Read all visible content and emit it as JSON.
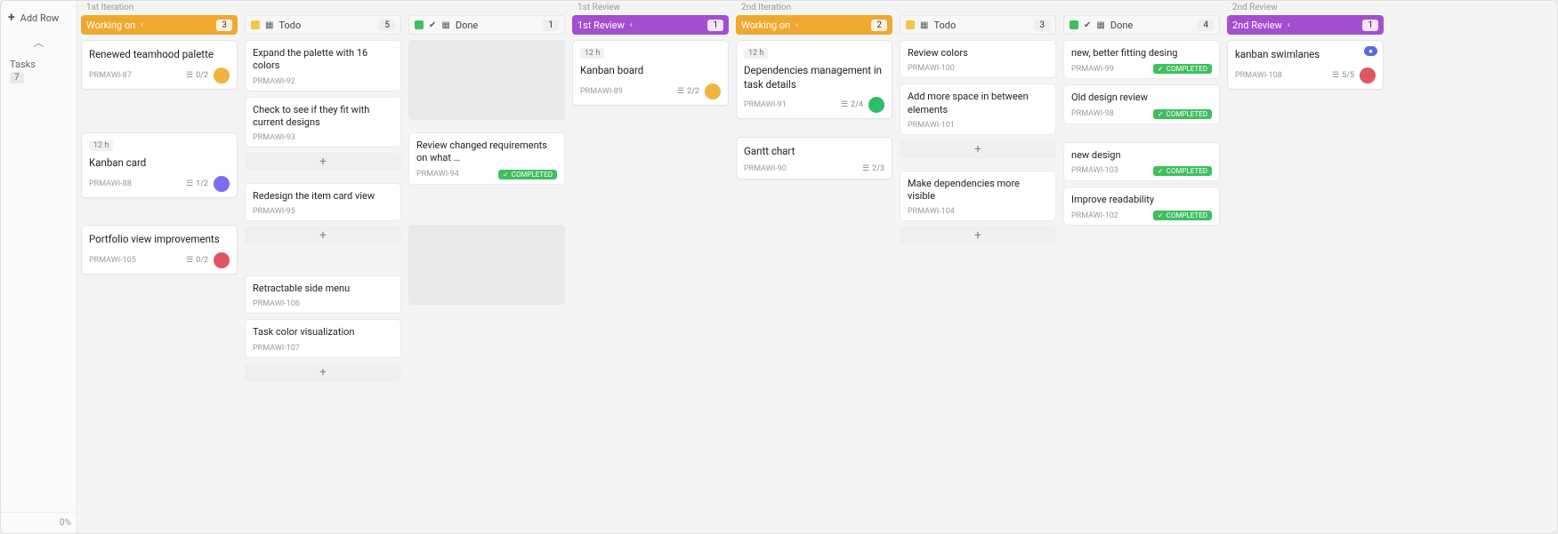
{
  "sidebar": {
    "add_row": "Add Row",
    "tasks_label": "Tasks",
    "tasks_count": "7",
    "progress": "0%"
  },
  "stages": [
    {
      "label": "1st Iteration"
    },
    {
      "label": "1st Review"
    },
    {
      "label": "2nd Iteration"
    },
    {
      "label": "2nd Review"
    }
  ],
  "columns": {
    "s1_working": {
      "title": "Working on",
      "count": "3"
    },
    "s1_todo": {
      "title": "Todo",
      "count": "5"
    },
    "s1_done": {
      "title": "Done",
      "count": "1"
    },
    "s1_review": {
      "title": "1st Review",
      "count": "1"
    },
    "s2_working": {
      "title": "Working on",
      "count": "2"
    },
    "s2_todo": {
      "title": "Todo",
      "count": "3"
    },
    "s2_done": {
      "title": "Done",
      "count": "4"
    },
    "s2_review": {
      "title": "2nd Review",
      "count": "1"
    }
  },
  "labels": {
    "time_12h": "12 h",
    "completed": "COMPLETED"
  },
  "cards": {
    "c87": {
      "title": "Renewed teamhood palette",
      "code": "PRMAWI-87",
      "sub": "0/2"
    },
    "c92": {
      "title": "Expand the palette with 16 colors",
      "code": "PRMAWI-92"
    },
    "c93": {
      "title": "Check to see if they fit with current designs",
      "code": "PRMAWI-93"
    },
    "c88": {
      "title": "Kanban card",
      "code": "PRMAWI-88",
      "sub": "1/2"
    },
    "c95": {
      "title": "Redesign the item card view",
      "code": "PRMAWI-95"
    },
    "c94": {
      "title": "Review changed requirements on what …",
      "code": "PRMAWI-94"
    },
    "c105": {
      "title": "Portfolio view improvements",
      "code": "PRMAWI-105",
      "sub": "0/2"
    },
    "c106": {
      "title": "Retractable side menu",
      "code": "PRMAWI-106"
    },
    "c107": {
      "title": "Task color visualization",
      "code": "PRMAWI-107"
    },
    "c89": {
      "title": "Kanban board",
      "code": "PRMAWI-89",
      "sub": "2/2"
    },
    "c91": {
      "title": "Dependencies management in task details",
      "code": "PRMAWI-91",
      "sub": "2/4"
    },
    "c100": {
      "title": "Review colors",
      "code": "PRMAWI-100"
    },
    "c101": {
      "title": "Add more space in between elements",
      "code": "PRMAWI-101"
    },
    "c99": {
      "title": "new, better fitting desing",
      "code": "PRMAWI-99"
    },
    "c98": {
      "title": "Old design review",
      "code": "PRMAWI-98"
    },
    "c90": {
      "title": "Gantt chart",
      "code": "PRMAWI-90",
      "sub": "2/3"
    },
    "c104": {
      "title": "Make dependencies more visible",
      "code": "PRMAWI-104"
    },
    "c103": {
      "title": "new design",
      "code": "PRMAWI-103"
    },
    "c102": {
      "title": "Improve readability",
      "code": "PRMAWI-102"
    },
    "c108": {
      "title": "kanban swimlanes",
      "code": "PRMAWI-108",
      "sub": "5/5"
    }
  }
}
